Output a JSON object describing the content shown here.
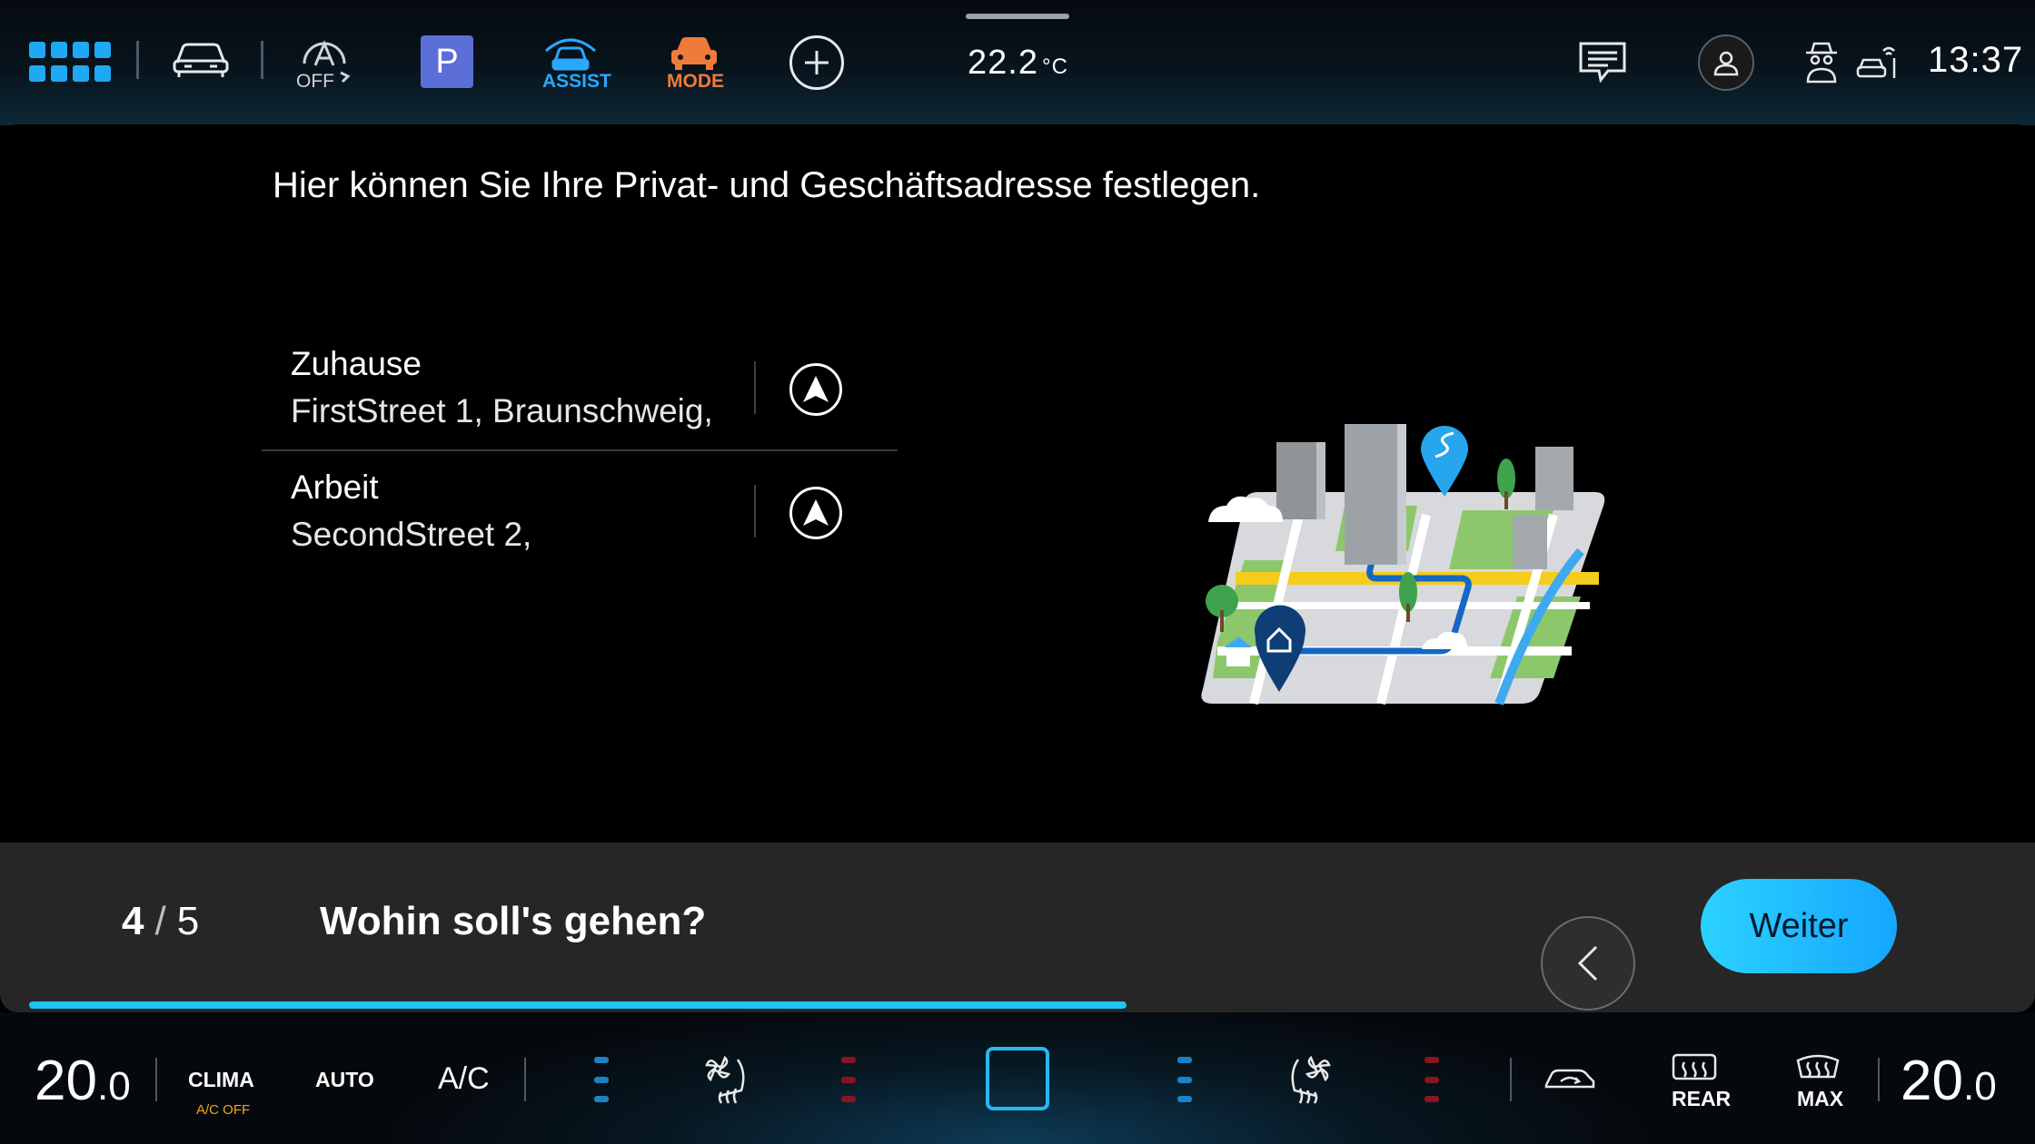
{
  "topbar": {
    "assist_off_label": "OFF",
    "parking_label": "P",
    "assist_label": "ASSIST",
    "mode_label": "MODE",
    "temperature_value": "22.2",
    "temperature_unit": "°C",
    "time": "13:37",
    "colors": {
      "accent": "#1fa9f4",
      "parking_bg": "#5b6fd6",
      "mode": "#ef7b3a"
    }
  },
  "content": {
    "intro": "Hier können Sie Ihre Privat- und Geschäftsadresse festlegen.",
    "addresses": [
      {
        "title": "Zuhause",
        "line": "FirstStreet 1, Braunschweig,",
        "icon": "navigate-arrow-icon"
      },
      {
        "title": "Arbeit",
        "line": "SecondStreet 2,",
        "icon": "navigate-arrow-icon"
      }
    ]
  },
  "wizard": {
    "step_current": "4",
    "step_separator": "/",
    "step_total": "5",
    "question": "Wohin soll's gehen?",
    "next_label": "Weiter",
    "progress": 0.555
  },
  "climate": {
    "left_temp_int": "20",
    "left_temp_dec": ".0",
    "clima_label": "CLIMA",
    "ac_off_label": "A/C OFF",
    "auto_label": "AUTO",
    "ac_label": "A/C",
    "rear_label": "REAR",
    "max_label": "MAX",
    "right_temp_int": "20",
    "right_temp_dec": ".0",
    "colors": {
      "cool": "#1d82c5",
      "warm": "#8a1420",
      "ac_off": "#f2a614"
    }
  }
}
